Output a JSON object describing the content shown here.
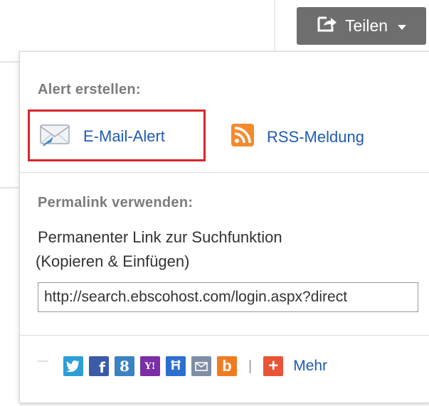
{
  "share": {
    "label": "Teilen"
  },
  "alert": {
    "heading": "Alert erstellen:",
    "email_label": "E-Mail-Alert",
    "rss_label": "RSS-Meldung"
  },
  "permalink": {
    "heading": "Permalink verwenden:",
    "desc_line1": "Permanenter Link zur Suchfunktion",
    "desc_line2": "(Kopieren & Einfügen)",
    "url": "http://search.ebscohost.com/login.aspx?direct"
  },
  "social": {
    "items": [
      {
        "name": "delicious",
        "color": "#3274d1",
        "glyph": ""
      },
      {
        "name": "twitter",
        "color": "#2c9fd8",
        "glyph": "t"
      },
      {
        "name": "facebook",
        "color": "#3b5ba6",
        "glyph": "f"
      },
      {
        "name": "google",
        "color": "#3b82c4",
        "glyph": "8"
      },
      {
        "name": "yahoo",
        "color": "#7b2ea5",
        "glyph": "Y!"
      },
      {
        "name": "hatena",
        "color": "#2d6fcf",
        "glyph": "H"
      },
      {
        "name": "email",
        "color": "#7e8fa5",
        "glyph": "✉"
      },
      {
        "name": "blogger",
        "color": "#f07c21",
        "glyph": "b"
      }
    ],
    "separator": "|",
    "more_label": "Mehr",
    "more_color": "#e95336"
  },
  "colors": {
    "link": "#1f5bb5",
    "highlight": "#d9262c",
    "button_bg": "#6e6e6e"
  }
}
